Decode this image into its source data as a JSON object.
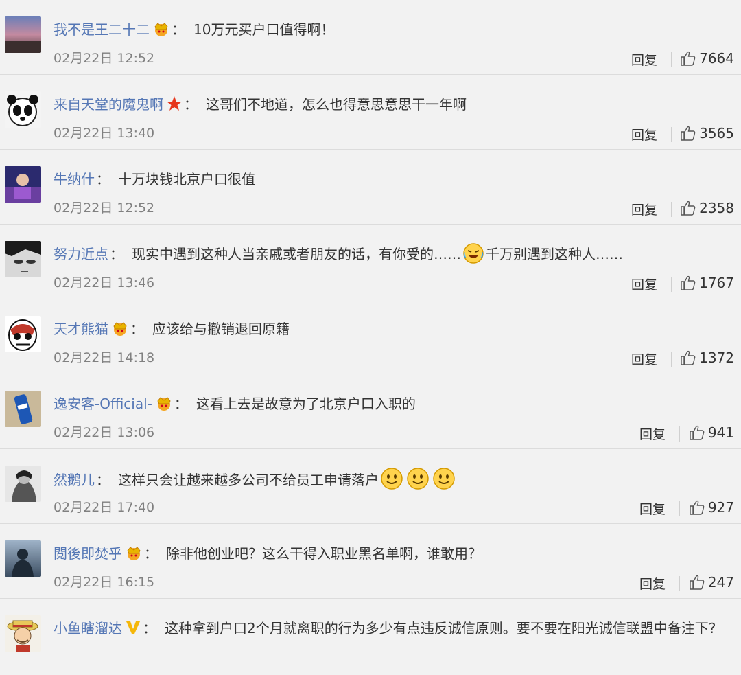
{
  "comments": [
    {
      "user": "我不是王二十二",
      "badge": "crown-icon",
      "text": "10万元买户口值得啊！",
      "time": "02月22日 12:52",
      "reply": "回复",
      "likes": "7664"
    },
    {
      "user": "来自天堂的魔鬼啊",
      "badge": "star-icon",
      "text": "这哥们不地道，怎么也得意思意思干一年啊",
      "time": "02月22日 13:40",
      "reply": "回复",
      "likes": "3565"
    },
    {
      "user": "牛纳什",
      "badge": "",
      "text": "十万块钱北京户口很值",
      "time": "02月22日 12:52",
      "reply": "回复",
      "likes": "2358"
    },
    {
      "user": "努力近点",
      "badge": "",
      "text_a": "现实中遇到这种人当亲戚或者朋友的话，有你受的……",
      "text_b": "千万别遇到这种人……",
      "emoji": "laughing-tears-emoji",
      "time": "02月22日 13:46",
      "reply": "回复",
      "likes": "1767"
    },
    {
      "user": "天才熊猫",
      "badge": "crown-icon",
      "text": "应该给与撤销退回原籍",
      "time": "02月22日 14:18",
      "reply": "回复",
      "likes": "1372"
    },
    {
      "user": "逸安客-Official-",
      "badge": "crown-icon",
      "text": "这看上去是故意为了北京户口入职的",
      "time": "02月22日 13:06",
      "reply": "回复",
      "likes": "941"
    },
    {
      "user": "然鹅儿",
      "badge": "",
      "text": "这样只会让越来越多公司不给员工申请落户",
      "emoji": "smile-emoji",
      "time": "02月22日 17:40",
      "reply": "回复",
      "likes": "927"
    },
    {
      "user": "閲後即焚乎",
      "badge": "crown-icon",
      "text": "除非他创业吧？这么干得入职业黑名单啊，谁敢用？",
      "time": "02月22日 16:15",
      "reply": "回复",
      "likes": "247"
    },
    {
      "user": "小鱼瞎溜达",
      "badge": "v-icon",
      "text": "这种拿到户口2个月就离职的行为多少有点违反诚信原则。要不要在阳光诚信联盟中备注下?"
    }
  ],
  "colors": {
    "username": "#5577b5",
    "text": "#333333",
    "time": "#808080",
    "background": "#f2f2f2"
  }
}
